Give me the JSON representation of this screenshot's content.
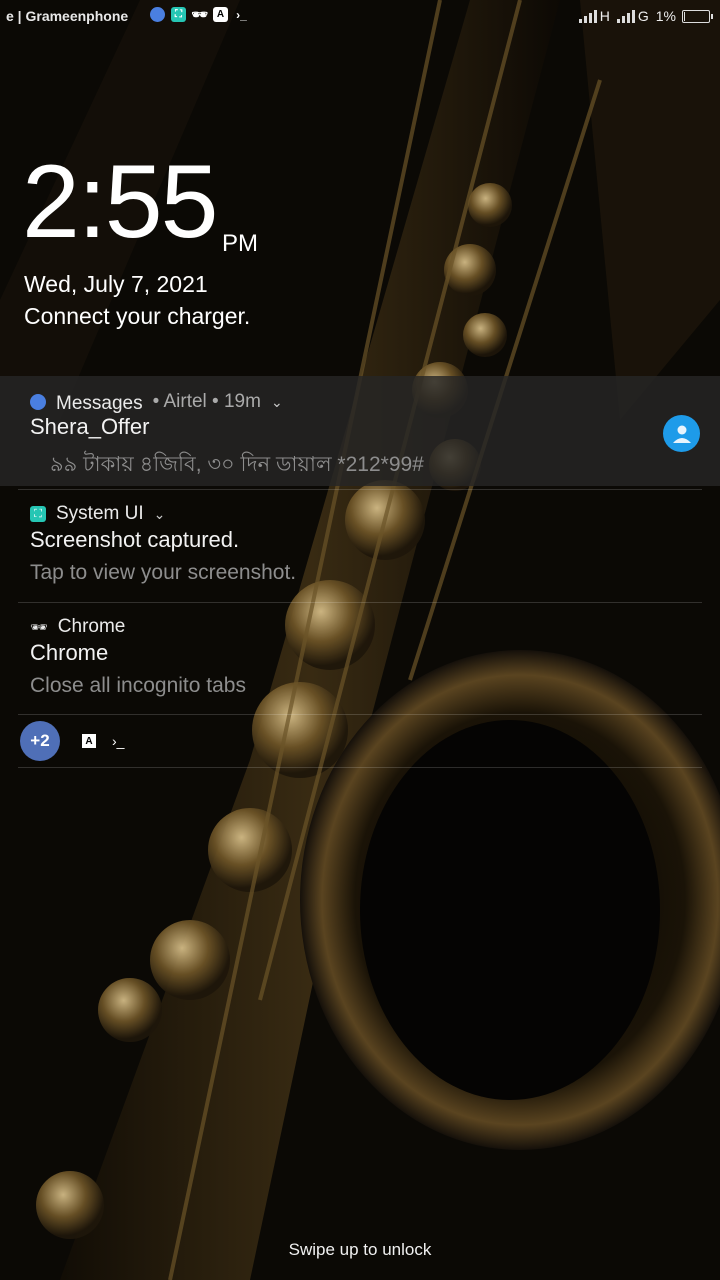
{
  "statusbar": {
    "carrier": "e | Grameenphone",
    "network_1": "H",
    "network_2": "G",
    "battery": "1%",
    "left_icons": [
      "messages-icon",
      "screenshot-icon",
      "incognito-icon",
      "a-icon",
      "terminal-icon"
    ]
  },
  "lock": {
    "time": "2:55",
    "ampm": "PM",
    "date": "Wed, July 7, 2021",
    "charger": "Connect your charger."
  },
  "notifications": [
    {
      "app": "Messages",
      "meta": "• Airtel • 19m",
      "title": "Shera_Offer",
      "body": "৯৯ টাকায় ৪জিবি, ৩০ দিন ডায়াল *212*99#",
      "icon": "messages-icon",
      "color": "#4a7fe0"
    },
    {
      "app": "System UI",
      "title": "Screenshot captured.",
      "body": "Tap to view your screenshot.",
      "icon": "screenshot-icon",
      "color": "#26c6b4"
    },
    {
      "app": "Chrome",
      "title": "Chrome",
      "body": "Close all incognito tabs",
      "icon": "incognito-icon"
    }
  ],
  "overflow": {
    "count": "+2",
    "terminal": "›_"
  },
  "unlock_hint": "Swipe up to unlock",
  "colors": {
    "accent": "#1e9be9",
    "overflow_badge": "#4f6fb7",
    "wallpaper_tint": "#b8934a"
  }
}
